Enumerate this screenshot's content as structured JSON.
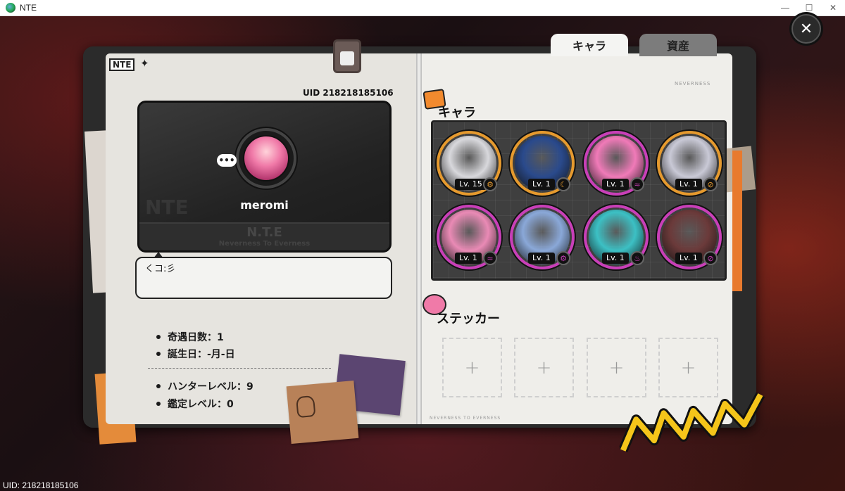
{
  "window": {
    "title": "NTE",
    "controls": [
      "—",
      "☐",
      "✕"
    ]
  },
  "close_button": {
    "label": "✕"
  },
  "tabs": [
    {
      "label": "キャラ",
      "active": true
    },
    {
      "label": "資産",
      "active": false
    }
  ],
  "left_page": {
    "logo": "NTE",
    "uid_label": "UID 218218185106",
    "profile": {
      "name": "meromi",
      "more_button": "•••",
      "watermark_title": "N.T.E",
      "watermark_subtitle": "Neverness To Everness"
    },
    "bio": "くコ:彡",
    "stats_group1": [
      {
        "label": "奇遇日数：1"
      },
      {
        "label": "誕生日：-月-日"
      }
    ],
    "stats_group2": [
      {
        "label": "ハンターレベル：9"
      },
      {
        "label": "鑑定レベル：0"
      }
    ]
  },
  "right_page": {
    "brand": "NEVERNESS",
    "character_section": {
      "heading": "キャラ",
      "characters": [
        {
          "level": "Lv. 15",
          "ring": "#e69a2e",
          "portrait": "#d8d8dc",
          "element": "gear-icon",
          "element_glyph": "⚙"
        },
        {
          "level": "Lv. 1",
          "ring": "#e69a2e",
          "portrait": "#2a4a8c",
          "element": "moon-icon",
          "element_glyph": "☾"
        },
        {
          "level": "Lv. 1",
          "ring": "#c93fb8",
          "portrait": "#f07ab8",
          "element": "wave-icon",
          "element_glyph": "≈"
        },
        {
          "level": "Lv. 1",
          "ring": "#e69a2e",
          "portrait": "#c9c9d6",
          "element": "cross-circle-icon",
          "element_glyph": "⊘"
        },
        {
          "level": "Lv. 1",
          "ring": "#c93fb8",
          "portrait": "#e98ab5",
          "element": "wave-icon",
          "element_glyph": "≈"
        },
        {
          "level": "Lv. 1",
          "ring": "#c93fb8",
          "portrait": "#8aa8d8",
          "element": "gear-icon",
          "element_glyph": "⚙"
        },
        {
          "level": "Lv. 1",
          "ring": "#c93fb8",
          "portrait": "#3cc0c4",
          "element": "leaf-icon",
          "element_glyph": "♨"
        },
        {
          "level": "Lv. 1",
          "ring": "#c93fb8",
          "portrait": "#6b3a3a",
          "element": "cross-circle-icon",
          "element_glyph": "⊘"
        }
      ]
    },
    "sticker_section": {
      "heading": "ステッカー",
      "slots": [
        "+",
        "+",
        "+",
        "+"
      ]
    },
    "footer_left": "NEVERNESS TO EVERNESS"
  },
  "bottom_uid": "UID: 218218185106",
  "colors": {
    "accent_orange": "#e69a2e",
    "accent_magenta": "#c93fb8",
    "gold_logo": "#f5c51a"
  }
}
